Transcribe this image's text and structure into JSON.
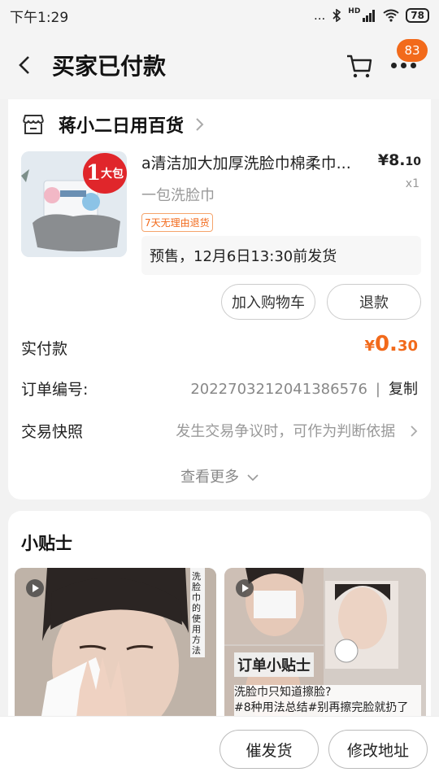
{
  "status_bar": {
    "time": "下午1:29",
    "signal_text": "...",
    "network": "HD",
    "battery": "78"
  },
  "nav": {
    "back_icon": "back-arrow-icon",
    "title": "买家已付款",
    "badge_count": "83"
  },
  "order": {
    "shop_name": "蒋小二日用百货",
    "product": {
      "image_badge_num": "1",
      "image_badge_text": "大包",
      "title": "a清洁加大加厚洗脸巾棉柔巾...",
      "price_symbol": "¥",
      "price_int": "8.",
      "price_dec": "10",
      "quantity": "x1",
      "spec": "一包洗脸巾",
      "tag": "7天无理由退货",
      "presale": "预售，12月6日13:30前发货"
    },
    "buttons": {
      "add_to_cart": "加入购物车",
      "refund": "退款"
    },
    "paid_label": "实付款",
    "paid_symbol": "¥",
    "paid_int": "0.",
    "paid_dec": "30",
    "order_no_label": "订单编号:",
    "order_no": "2022703212041386576",
    "separator": "|",
    "copy_label": "复制",
    "snapshot_label": "交易快照",
    "snapshot_desc": "发生交易争议时，可作为判断依据",
    "see_more": "查看更多"
  },
  "tips": {
    "title": "小贴士",
    "video2_heading": "订单小贴士",
    "video2_text_1": "洗脸巾只知道擦脸?",
    "video2_text_2": "#8种用法总结#别再擦完脸就扔了",
    "video1_side_text": "洗脸巾的使用方法"
  },
  "bottom": {
    "urge_shipping": "催发货",
    "change_address": "修改地址"
  },
  "colors": {
    "accent": "#f26a1b",
    "badge_red": "#e0262b",
    "page_bg": "#f2f2f2"
  }
}
